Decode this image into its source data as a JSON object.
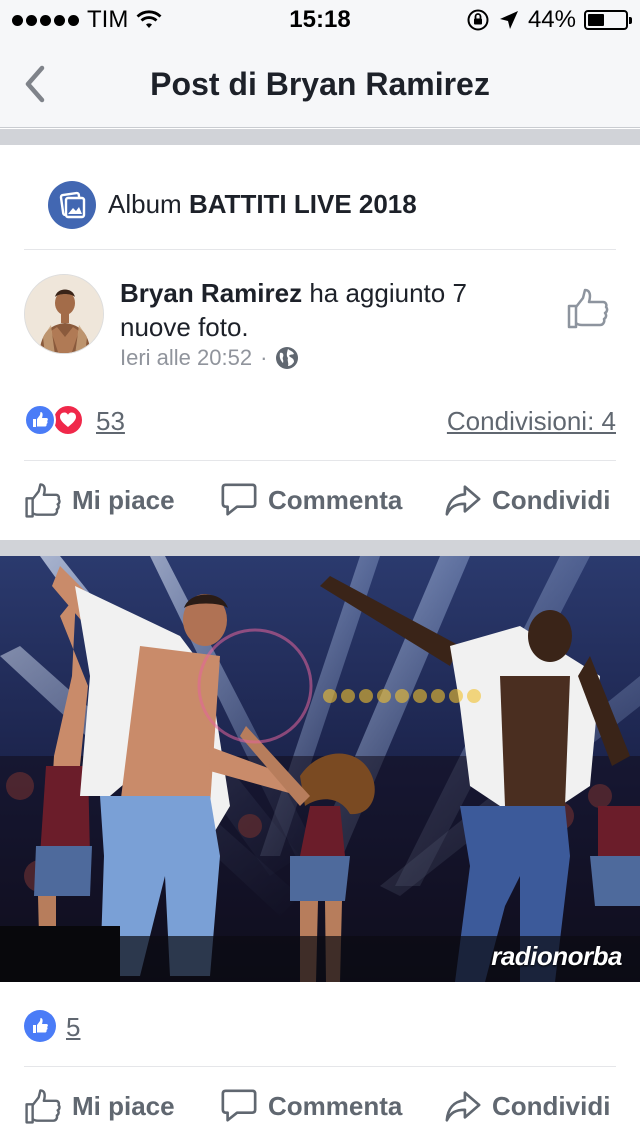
{
  "status_bar": {
    "carrier": "TIM",
    "time": "15:18",
    "battery_percent": "44%",
    "battery_level": 0.44
  },
  "nav": {
    "title": "Post di Bryan Ramirez"
  },
  "album": {
    "prefix": "Album",
    "name": "BATTITI LIVE 2018"
  },
  "post": {
    "author": "Bryan Ramirez",
    "action_text": "ha aggiunto 7 nuove foto.",
    "timestamp": "Ieri alle 20:52",
    "separator": "·",
    "reaction_count": "53",
    "shares": "Condivisioni: 4",
    "photo_watermark": "radionorba"
  },
  "actions": {
    "like": "Mi piace",
    "comment": "Commenta",
    "share": "Condividi"
  },
  "photo_post": {
    "reaction_count": "5"
  },
  "colors": {
    "brand_blue": "#4267b2",
    "like_blue": "#4a7cf7",
    "love_red": "#f0284a",
    "action_gray": "#606770"
  }
}
